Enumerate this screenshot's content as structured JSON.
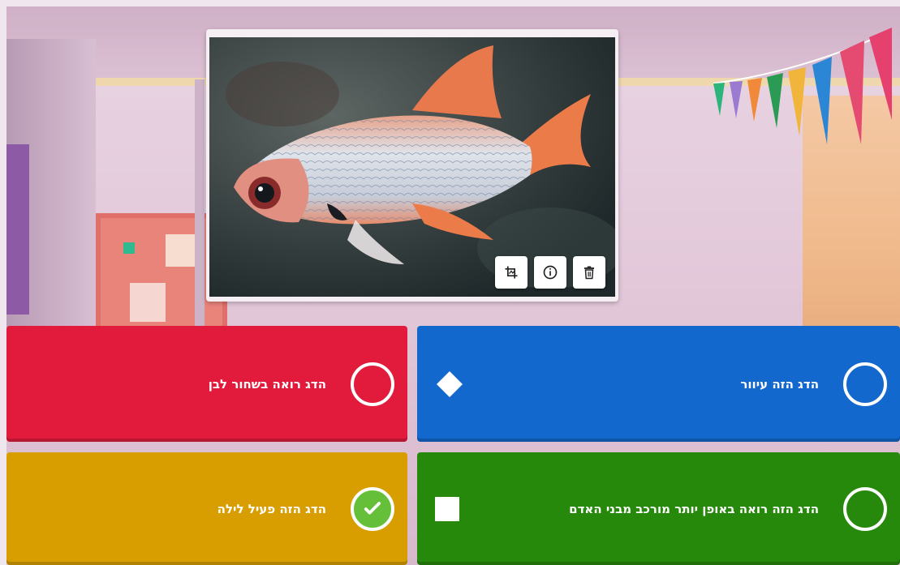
{
  "media_tools": {
    "icons": [
      "crop-icon",
      "info-icon",
      "trash-icon"
    ]
  },
  "answers": [
    {
      "color": "#e21b3c",
      "shape": "triangle",
      "text": "הדג רואה בשחור לבן",
      "correct": false
    },
    {
      "color": "#1368ce",
      "shape": "diamond",
      "text": "הדג הזה עיוור",
      "correct": false
    },
    {
      "color": "#d89e00",
      "shape": "circle",
      "text": "הדג הזה פעיל לילה",
      "correct": true
    },
    {
      "color": "#26890c",
      "shape": "square",
      "text": "הדג הזה רואה באופן יותר מורכב מבני האדם",
      "correct": false
    }
  ]
}
